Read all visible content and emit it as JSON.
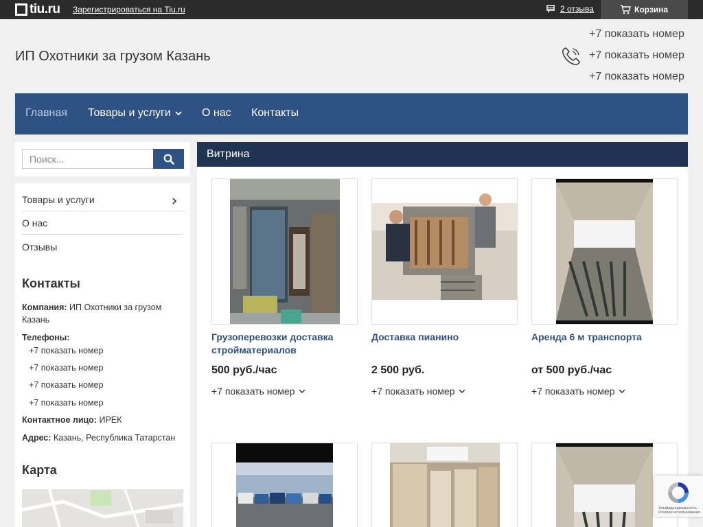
{
  "topbar": {
    "logo_text": "tiu.ru",
    "register_link": "Зарегистрироваться на Tiu.ru",
    "reviews_link": "2 отзыва",
    "cart_label": "Корзина"
  },
  "header": {
    "company_title": "ИП Охотники за грузом Казань",
    "phones": [
      "+7 показать номер",
      "+7 показать номер",
      "+7 показать номер"
    ]
  },
  "nav": {
    "items": [
      {
        "label": "Главная",
        "active": true
      },
      {
        "label": "Товары и услуги",
        "has_dropdown": true
      },
      {
        "label": "О нас"
      },
      {
        "label": "Контакты"
      }
    ]
  },
  "search": {
    "placeholder": "Поиск..."
  },
  "sidebar": {
    "menu": [
      {
        "label": "Товары и услуги"
      },
      {
        "label": "О нас"
      },
      {
        "label": "Отзывы"
      }
    ],
    "contacts_heading": "Контакты",
    "company_label": "Компания:",
    "company_value": "ИП Охотники за грузом Казань",
    "phones_label": "Телефоны:",
    "phones": [
      "+7 показать номер",
      "+7 показать номер",
      "+7 показать номер",
      "+7 показать номер"
    ],
    "contact_person_label": "Контактное лицо:",
    "contact_person_value": "ИРЕК",
    "address_label": "Адрес:",
    "address_value": "Казань, Республика Татарстан",
    "map_heading": "Карта"
  },
  "main": {
    "heading": "Витрина",
    "products": [
      {
        "title": "Грузоперевозки доставка стройматериалов",
        "price": "500 руб./час",
        "phone": "+7 показать номер"
      },
      {
        "title": "Доставка пианино",
        "price": "2 500 руб.",
        "phone": "+7 показать номер"
      },
      {
        "title": "Аренда 6 м транспорта",
        "price": "от 500 руб./час",
        "phone": "+7 показать номер"
      }
    ]
  },
  "recaptcha": {
    "text": "Конфиденциальность - Условия использования"
  },
  "colors": {
    "topbar": "#2b2b2b",
    "nav": "#2e5284",
    "vitrina_header": "#1f3353",
    "link": "#2e5284"
  }
}
